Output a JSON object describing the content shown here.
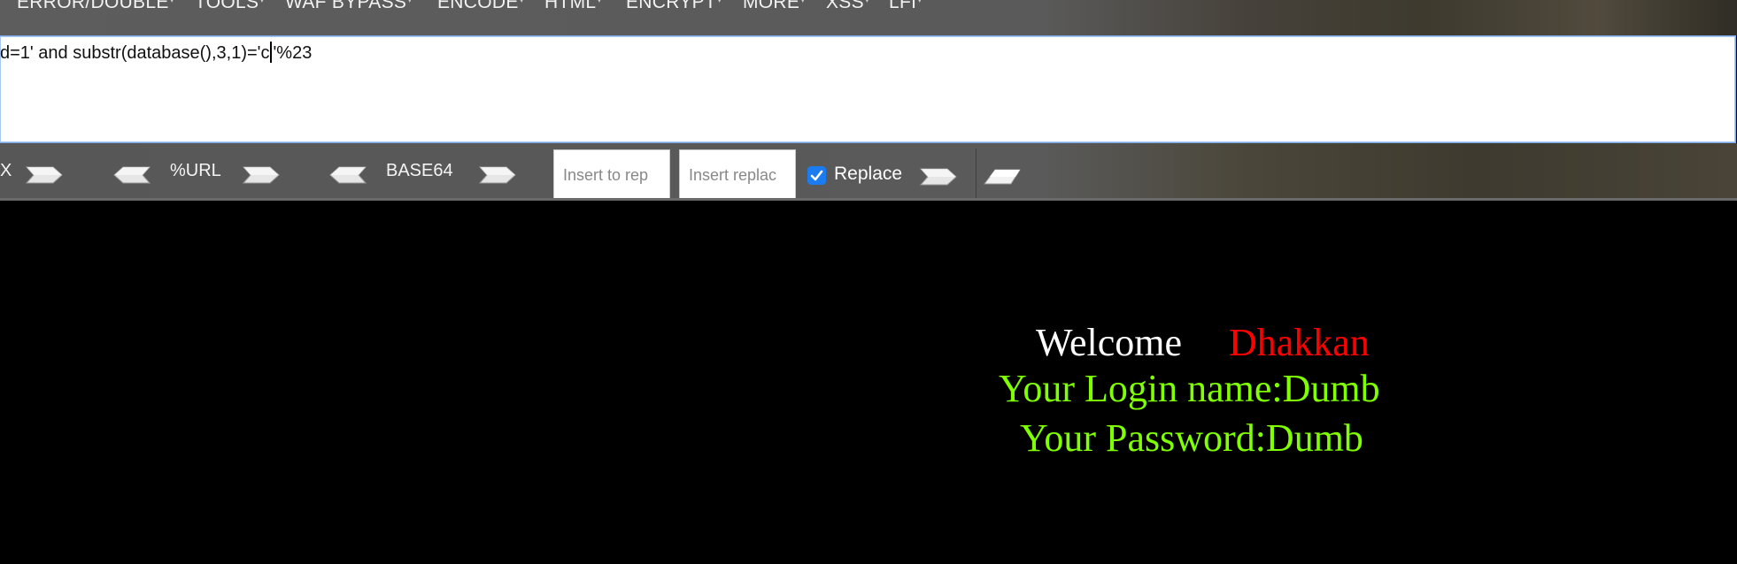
{
  "menu": {
    "items": [
      {
        "label": "ERROR/DOUBLE"
      },
      {
        "label": "TOOLS"
      },
      {
        "label": "WAF BYPASS"
      },
      {
        "label": "ENCODE"
      },
      {
        "label": "HTML"
      },
      {
        "label": "ENCRYPT"
      },
      {
        "label": "MORE"
      },
      {
        "label": "XSS"
      },
      {
        "label": "LFI"
      }
    ]
  },
  "url": {
    "before_caret": "d=1' and substr(database(),3,1)='c",
    "after_caret": "'%23"
  },
  "toolbar": {
    "hex_label": "X",
    "url_label": "%URL",
    "base64_label": "BASE64",
    "insert_to_replace_placeholder": "Insert to rep",
    "insert_replace_placeholder": "Insert replac",
    "replace_label": "Replace",
    "replace_checked": true
  },
  "page": {
    "welcome": "Welcome",
    "username": "Dhakkan",
    "login_line": "Your Login name:Dumb",
    "password_line": "Your Password:Dumb",
    "colors": {
      "welcome": "#ffffff",
      "username": "#ff0000",
      "info": "#7fff00"
    }
  }
}
